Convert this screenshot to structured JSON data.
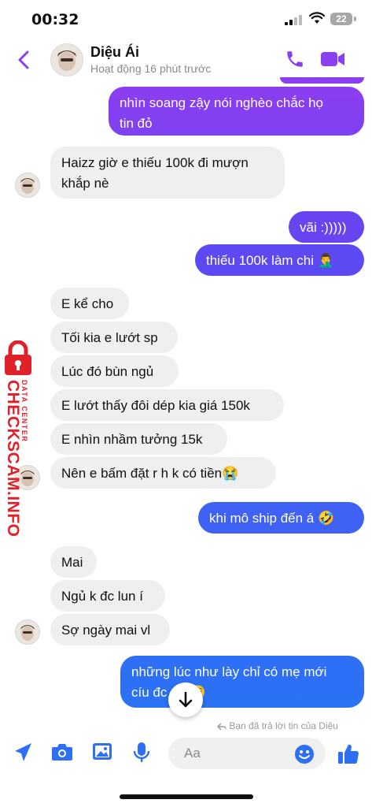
{
  "status_bar": {
    "time": "00:32",
    "battery": "22"
  },
  "header": {
    "contact_name": "Diệu Ái",
    "active_status": "Hoạt động 16 phút trước"
  },
  "messages": [
    {
      "side": "sent",
      "text": "nhìn soang zậy nói nghèo chắc họ\ntin đỏ"
    },
    {
      "side": "received",
      "text": "Haizz giờ e thiếu 100k đi mượn\nkhắp nè"
    },
    {
      "side": "sent",
      "text": "vãi :)))))"
    },
    {
      "side": "sent",
      "text": "thiếu 100k làm chi 🤦‍♂️"
    },
    {
      "side": "received",
      "text": "E kể cho"
    },
    {
      "side": "received",
      "text": "Tối kia e lướt sp"
    },
    {
      "side": "received",
      "text": "Lúc đó bùn ngủ"
    },
    {
      "side": "received",
      "text": "E lướt thấy đôi dép kia giá 150k"
    },
    {
      "side": "received",
      "text": "E nhìn nhầm tưởng 15k"
    },
    {
      "side": "received",
      "text": "Nên e bấm đặt r h k có tiền😭"
    },
    {
      "side": "sent",
      "text": "khi mô ship đến á 🤣"
    },
    {
      "side": "received",
      "text": "Mai"
    },
    {
      "side": "received",
      "text": "Ngủ k đc lun í"
    },
    {
      "side": "received",
      "text": "Sợ ngày mai vl"
    },
    {
      "side": "sent",
      "text": "những lúc như lày chỉ có mẹ mới\ncíu đc      😌"
    }
  ],
  "reply_note": "Bạn đã trả lời tin của Diệu",
  "watermark": {
    "line1": "DATA CENTER",
    "line2": "CHECKSCAM.INFO"
  },
  "composer": {
    "placeholder": "Aa"
  },
  "colors": {
    "sent_gradient_top": "#8a3ff0",
    "sent_gradient_mid": "#5b49f2",
    "sent_gradient_bottom": "#2f6ff5",
    "accent": "#8a3ff0",
    "composer_icons": "#2f6ff5",
    "watermark_red": "#e0212a"
  },
  "icons": [
    "back-chevron-icon",
    "phone-icon",
    "video-camera-icon",
    "arrow-down-icon",
    "location-arrow-icon",
    "camera-icon",
    "image-icon",
    "microphone-icon",
    "emoji-icon",
    "thumbs-up-icon"
  ]
}
